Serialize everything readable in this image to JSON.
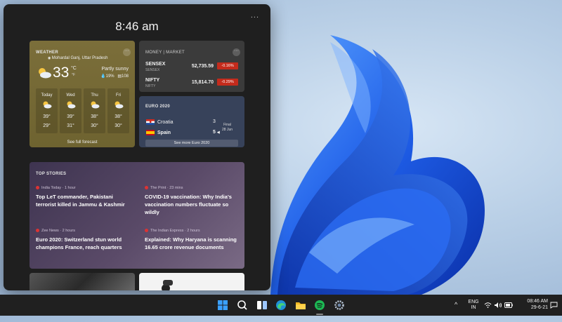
{
  "panel": {
    "time": "8:46 am",
    "more_label": "..."
  },
  "weather": {
    "title": "WEATHER",
    "location": "Mohardal Ganj, Uttar Pradesh",
    "temp": "33",
    "unit": "°C",
    "unit_alt": "°F",
    "condition": "Partly sunny",
    "precip": "19%",
    "aqi": "108",
    "forecast": [
      {
        "day": "Today",
        "hi": "39°",
        "lo": "29°"
      },
      {
        "day": "Wed",
        "hi": "39°",
        "lo": "31°"
      },
      {
        "day": "Thu",
        "hi": "38°",
        "lo": "30°"
      },
      {
        "day": "Fri",
        "hi": "38°",
        "lo": "30°"
      }
    ],
    "link": "See full forecast",
    "colors": {
      "sun": "#f5c542",
      "cloud": "#e9eef5"
    }
  },
  "money": {
    "title": "MONEY | MARKET",
    "rows": [
      {
        "name": "SENSEX",
        "sub": "SENSEX",
        "value": "52,735.59",
        "change": "-0.16%"
      },
      {
        "name": "NIFTY",
        "sub": "NIFTY",
        "value": "15,814.70",
        "change": "-0.29%"
      }
    ],
    "negative_color": "#c42b1c"
  },
  "euro": {
    "title": "EURO 2020",
    "team1": "Croatia",
    "score1": "3",
    "team2": "Spain",
    "score2": "5",
    "status": "Final",
    "date": "28 Jun",
    "button": "See more Euro 2020"
  },
  "stories": {
    "title": "TOP STORIES",
    "items": [
      {
        "source": "India Today · 1 hour",
        "headline": "Top LeT commander, Pakistani terrorist killed in Jammu & Kashmir"
      },
      {
        "source": "The Print · 23 mins",
        "headline": "COVID-19 vaccination: Why India's vaccination numbers fluctuate so wildly"
      },
      {
        "source": "Zee News · 2 hours",
        "headline": "Euro 2020: Switzerland stun world champions France, reach quarters"
      },
      {
        "source": "The Indian Express · 2 hours",
        "headline": "Explained: Why Haryana is scanning 16.65 crore revenue documents"
      }
    ]
  },
  "taskbar": {
    "icons": [
      "windows-start-icon",
      "search-icon",
      "task-view-icon",
      "edge-browser-icon",
      "file-explorer-icon",
      "spotify-icon",
      "settings-icon"
    ],
    "lang": "ENG",
    "region": "IN",
    "clock_time": "08:46 AM",
    "clock_date": "29-6-21",
    "chevron": "^"
  }
}
